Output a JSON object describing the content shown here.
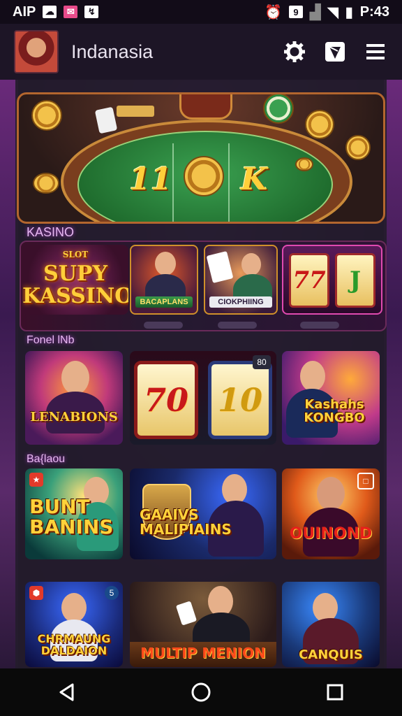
{
  "status_bar": {
    "left_text": "AIP",
    "time": "P:43",
    "icons": [
      "cloud-icon",
      "notification-icon",
      "signal-icon",
      "wifi-icon",
      "battery-icon"
    ]
  },
  "header": {
    "title": "Indanasia",
    "icons": [
      "avatar",
      "settings-icon",
      "send-icon",
      "menu-icon"
    ]
  },
  "hero": {
    "glyphs": [
      "11",
      "K"
    ]
  },
  "sections": {
    "kasino": "KASINO",
    "second": "Fonel lNb",
    "third": "Ba{laou"
  },
  "kasino_strip": {
    "logo": "SUPY\nKASSINO",
    "logo_small": "SLOT",
    "cards": [
      {
        "caption": "BACAPLANS"
      },
      {
        "caption": "CIOKPHIING"
      },
      {
        "caption": "77"
      }
    ]
  },
  "grid": {
    "row1": [
      {
        "title": "LENABIONS",
        "badge": ""
      },
      {
        "reel1": "70",
        "reel2": "10",
        "badge": "80"
      },
      {
        "title": "Kashahs\nKONGBO"
      }
    ],
    "row2": [
      {
        "title": "BUNT\nBANINS"
      },
      {
        "title": "GAAIVS\nMALIPIAINS"
      },
      {
        "title": "OUINOND"
      }
    ],
    "row3": [
      {
        "title": "CHRMAUNG\nDALDAION"
      },
      {
        "title": "MULTIP MENION"
      },
      {
        "title": "CANQUIS"
      }
    ]
  },
  "colors": {
    "accent_gold": "#ffd23a",
    "background": "#1a0f24",
    "label_glow": "#e6b8f0"
  }
}
